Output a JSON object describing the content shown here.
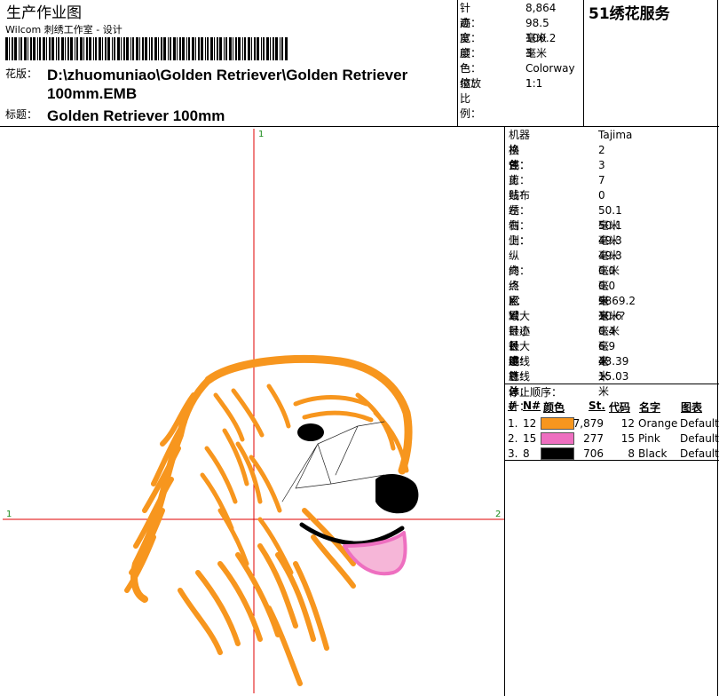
{
  "header": {
    "title": "生产作业图",
    "subtitle": "Wilcom 刺绣工作室 - 设计",
    "design_label": "花版：",
    "design_path": "D:\\zhuomuniao\\Golden Retriever\\Golden Retriever 100mm.EMB",
    "title_label": "标题：",
    "title_value": "Golden Retriever 100mm"
  },
  "summary": [
    {
      "key": "针迹：",
      "value": "8,864"
    },
    {
      "key": "高度：",
      "value": "98.5 毫米"
    },
    {
      "key": "宽度：",
      "value": "100.2 毫米"
    },
    {
      "key": "颜色：",
      "value": "3"
    },
    {
      "key": "色位：",
      "value": "Colorway 1"
    },
    {
      "key": "缩放比例：",
      "value": "1:1"
    }
  ],
  "brand": "51绣花服务",
  "machine_info": [
    {
      "key": "机器格式：",
      "value": "Tajima"
    },
    {
      "key": "换色：",
      "value": "2"
    },
    {
      "key": "停止：",
      "value": "3"
    },
    {
      "key": "剪线：",
      "value": "7"
    },
    {
      "key": "贴布绣：",
      "value": "0"
    },
    {
      "key": "左侧：",
      "value": "50.1 毫米"
    },
    {
      "key": "右侧：",
      "value": "50.1 毫米"
    },
    {
      "key": "上：",
      "value": "49.3 毫米"
    },
    {
      "key": "纵向：",
      "value": "49.3 毫米"
    },
    {
      "key": "终点 X：",
      "value": "0.0 毫米"
    },
    {
      "key": "终点 Y：",
      "value": "0.0 毫米"
    },
    {
      "key": "区域",
      "value": "9869.2 毫米?"
    },
    {
      "key": "最大针迹长度：",
      "value": "10.6 毫米"
    },
    {
      "key": "最小针迹：",
      "value": "0.4 毫米"
    },
    {
      "key": "最大跳针：",
      "value": "6.9 毫米"
    },
    {
      "key": "绣线总计：",
      "value": "43.39米"
    },
    {
      "key": "底线总计：",
      "value": "15.03米"
    }
  ],
  "stop_sequence": {
    "heading": "停止顺序：",
    "columns": {
      "num": "#",
      "needle": "N#",
      "color": "颜色",
      "stitches": "St.",
      "code": "代码",
      "name": "名字",
      "chart": "图表"
    },
    "rows": [
      {
        "num": "1.",
        "needle": "12",
        "color": "#F7961E",
        "stitches": "7,879",
        "code": "12",
        "name": "Orange",
        "chart": "Default"
      },
      {
        "num": "2.",
        "needle": "15",
        "color": "#EE6FC0",
        "stitches": "277",
        "code": "15",
        "name": "Pink",
        "chart": "Default"
      },
      {
        "num": "3.",
        "needle": "8",
        "color": "#000000",
        "stitches": "706",
        "code": "8",
        "name": "Black",
        "chart": "Default"
      }
    ]
  },
  "canvas": {
    "axis_labels": {
      "top": "1",
      "left": "1",
      "right": "2"
    },
    "crosshair_color": "#E00000",
    "thread_colors": {
      "orange": "#F7961E",
      "pink": "#EE6FC0",
      "black": "#000000"
    }
  }
}
